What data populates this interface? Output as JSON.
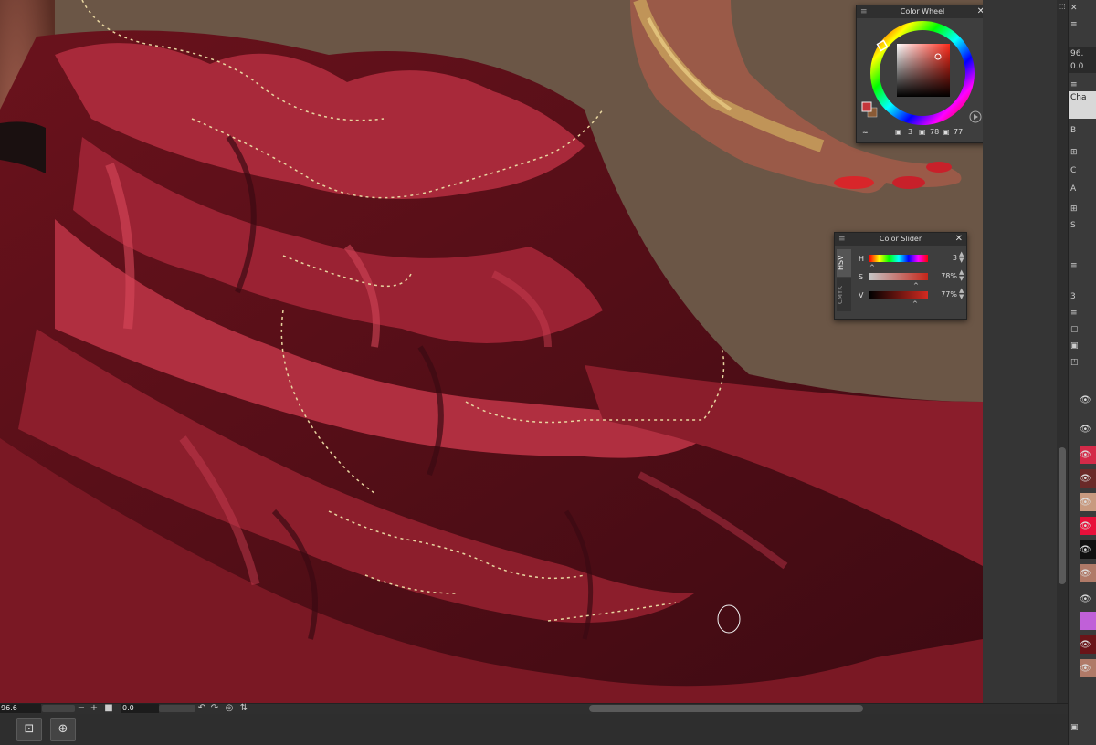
{
  "canvas": {
    "background_color": "#6b5646",
    "fabric_colors": [
      "#8e1c2a",
      "#b02a38",
      "#5a0f18",
      "#c8364a",
      "#3b0a12"
    ],
    "trim_color": "#e8d6a0"
  },
  "color_wheel": {
    "title": "Color Wheel",
    "main_color": "#c4363a",
    "sub_color": "#8a5a35",
    "h_value": "3",
    "s_value": "78",
    "v_value": "77"
  },
  "color_slider": {
    "title": "Color Slider",
    "tab_hsv": "HSV",
    "tab_cmyk": "CMYK",
    "rows": [
      {
        "label": "H",
        "value": "3"
      },
      {
        "label": "S",
        "value": "78%"
      },
      {
        "label": "V",
        "value": "77%"
      }
    ]
  },
  "status_bar": {
    "zoom": "96.6",
    "angle": "0.0"
  },
  "right_panel": {
    "zoom_value": "96.",
    "zoom_value2": "0.0",
    "tab_label": "Cha",
    "row_letters": [
      "B",
      "C",
      "A",
      "S"
    ],
    "number_value": "3",
    "layer_swatches": [
      "#d42a48",
      "#6a2a28",
      "#c89a80",
      "#e8103a",
      "#111111",
      "#b07a68",
      "#c060d8",
      "#6a1418",
      "#b07a68"
    ]
  },
  "bottom_toolbar": {
    "buttons": [
      "fit-screen-icon",
      "view-center-icon"
    ]
  }
}
